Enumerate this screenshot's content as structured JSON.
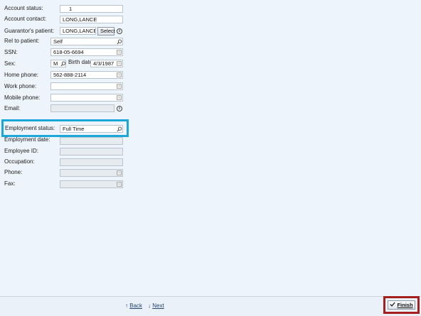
{
  "form": {
    "account_status": {
      "label": "Account status:",
      "value": "1"
    },
    "account_contact": {
      "label": "Account contact:",
      "value": "LONG,LANCE"
    },
    "guarantors_patient": {
      "label": "Guarantor's patient:",
      "value": "LONG,LANCE",
      "button": "Select"
    },
    "rel_to_patient": {
      "label": "Rel to patient:",
      "value": "Self"
    },
    "ssn": {
      "label": "SSN:",
      "value": "618-05-6694"
    },
    "sex": {
      "label": "Sex:",
      "value": "M"
    },
    "birth_date": {
      "label": "Birth date:",
      "value": "4/3/1987"
    },
    "home_phone": {
      "label": "Home phone:",
      "value": "562-888-2114"
    },
    "work_phone": {
      "label": "Work phone:",
      "value": ""
    },
    "mobile_phone": {
      "label": "Mobile phone:",
      "value": ""
    },
    "email": {
      "label": "Email:",
      "value": ""
    },
    "employment_status": {
      "label": "Employment status:",
      "value": "Full Time"
    },
    "employment_date": {
      "label": "Employment date:",
      "value": ""
    },
    "employee_id": {
      "label": "Employee ID:",
      "value": ""
    },
    "occupation": {
      "label": "Occupation:",
      "value": ""
    },
    "phone": {
      "label": "Phone:",
      "value": ""
    },
    "fax": {
      "label": "Fax:",
      "value": ""
    }
  },
  "footer": {
    "back_label": "Back",
    "next_label": "Next",
    "finish_label": "Finish"
  },
  "colors": {
    "background": "#eef4fb",
    "highlight_employment": "#19a8d8",
    "highlight_finish": "#a51f1f"
  },
  "icons": {
    "search": "magnifier-icon",
    "calendar": "calendar-icon",
    "info": "info-icon",
    "back": "arrow-up-icon",
    "next": "arrow-down-icon",
    "finish": "checkmark-icon"
  }
}
